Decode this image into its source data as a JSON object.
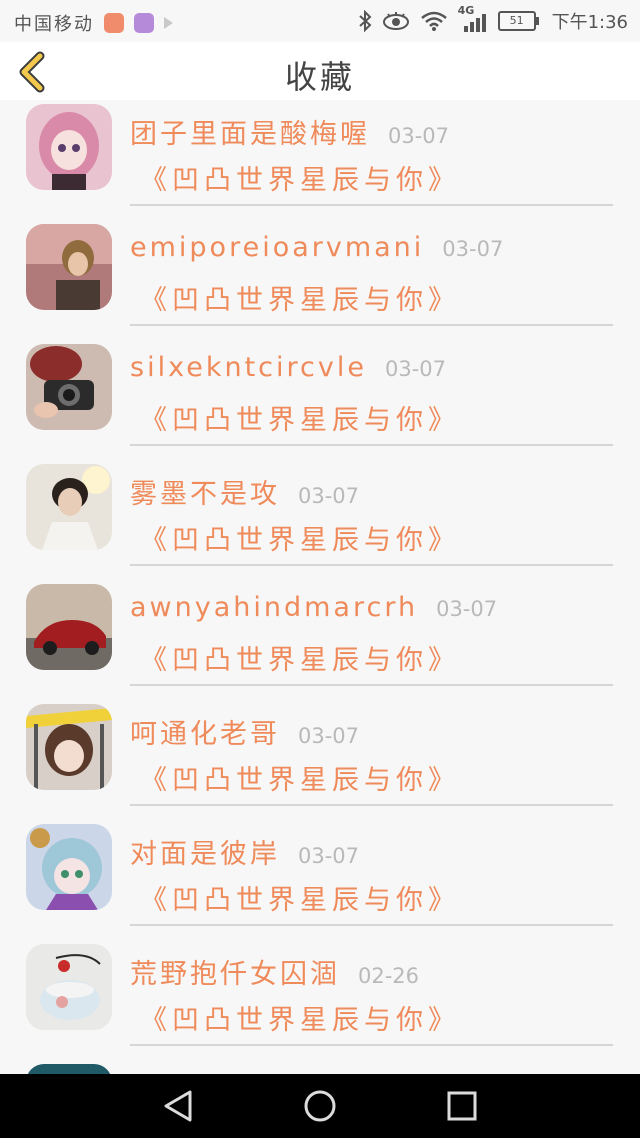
{
  "status_bar": {
    "carrier": "中国移动",
    "battery": "51",
    "time": "下午1:36",
    "network": "4G"
  },
  "header": {
    "title": "收藏"
  },
  "favorites": [
    {
      "user": "团子里面是酸梅喔",
      "date": "03-07",
      "work": "《凹凸世界星辰与你》"
    },
    {
      "user": "emiporeioarvmani",
      "date": "03-07",
      "work": "《凹凸世界星辰与你》"
    },
    {
      "user": "silxekntcircvle",
      "date": "03-07",
      "work": "《凹凸世界星辰与你》"
    },
    {
      "user": "雾墨不是攻",
      "date": "03-07",
      "work": "《凹凸世界星辰与你》"
    },
    {
      "user": "awnyahindmarcrh",
      "date": "03-07",
      "work": "《凹凸世界星辰与你》"
    },
    {
      "user": "呵通化老哥",
      "date": "03-07",
      "work": "《凹凸世界星辰与你》"
    },
    {
      "user": "对面是彼岸",
      "date": "03-07",
      "work": "《凹凸世界星辰与你》"
    },
    {
      "user": "荒野抱仟女囚涸",
      "date": "02-26",
      "work": "《凹凸世界星辰与你》"
    }
  ],
  "icons": {
    "back": "chevron-left-icon",
    "nav_back": "triangle-back-icon",
    "nav_home": "circle-home-icon",
    "nav_recent": "square-recent-icon"
  },
  "colors": {
    "accent": "#ef8a5a",
    "back_arrow": "#f2c94c",
    "date": "#b9b9b9"
  }
}
